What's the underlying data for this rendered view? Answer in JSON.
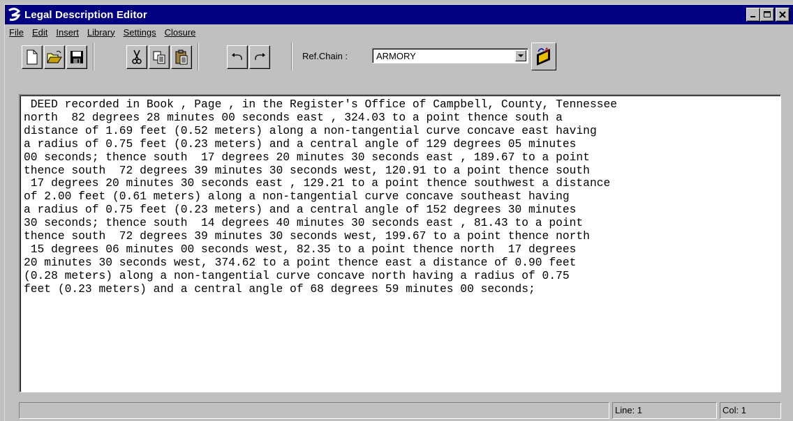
{
  "window": {
    "title": "Legal Description Editor",
    "title_icon": "app-logo-icon"
  },
  "menu": {
    "items": [
      "File",
      "Edit",
      "Insert",
      "Library",
      "Settings",
      "Closure"
    ]
  },
  "toolbar": {
    "buttons": [
      {
        "name": "new-document-icon"
      },
      {
        "name": "open-folder-icon"
      },
      {
        "name": "save-icon"
      },
      {
        "name": "cut-icon"
      },
      {
        "name": "copy-icon"
      },
      {
        "name": "paste-icon"
      },
      {
        "name": "undo-icon"
      },
      {
        "name": "redo-icon"
      }
    ],
    "refchain_label": "Ref.Chain :",
    "refchain_value": "ARMORY",
    "action_icon": "edit-chain-icon"
  },
  "editor": {
    "lines": [
      " DEED recorded in Book , Page , in the Register's Office of Campbell, County, Tennessee",
      "north  82 degrees 28 minutes 00 seconds east , 324.03 to a point thence south a",
      "distance of 1.69 feet (0.52 meters) along a non-tangential curve concave east having",
      "a radius of 0.75 feet (0.23 meters) and a central angle of 129 degrees 05 minutes",
      "00 seconds; thence south  17 degrees 20 minutes 30 seconds east , 189.67 to a point",
      "thence south  72 degrees 39 minutes 30 seconds west, 120.91 to a point thence south",
      " 17 degrees 20 minutes 30 seconds east , 129.21 to a point thence southwest a distance",
      "of 2.00 feet (0.61 meters) along a non-tangential curve concave southeast having",
      "a radius of 0.75 feet (0.23 meters) and a central angle of 152 degrees 30 minutes",
      "30 seconds; thence south  14 degrees 40 minutes 30 seconds east , 81.43 to a point",
      "thence south  72 degrees 39 minutes 30 seconds west, 199.67 to a point thence north",
      " 15 degrees 06 minutes 00 seconds west, 82.35 to a point thence north  17 degrees",
      "20 minutes 30 seconds west, 374.62 to a point thence east a distance of 0.90 feet",
      "(0.28 meters) along a non-tangential curve concave north having a radius of 0.75",
      "feet (0.23 meters) and a central angle of 68 degrees 59 minutes 00 seconds;"
    ]
  },
  "status": {
    "message": "",
    "line": "Line: 1",
    "col": "Col: 1"
  }
}
